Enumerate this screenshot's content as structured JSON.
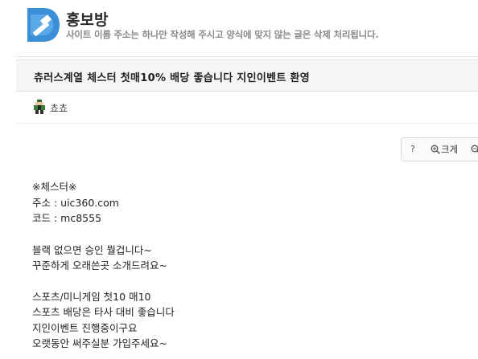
{
  "board": {
    "title": "홍보방",
    "description": "사이트 이름 주소는 하나만 작성해 주시고 양식에 맞지 않는 글은 삭제 처리됩니다."
  },
  "post": {
    "title": "츄러스계열 체스터 첫매10% 배당 좋습니다 지인이벤트 환영",
    "author": "쵸쵸"
  },
  "font_tools": {
    "help_label": "?",
    "enlarge_label": "크게"
  },
  "content": {
    "line1": "※체스터※",
    "line2": "주소 : uic360.com",
    "line3": "코드 : mc8555",
    "line4": "블랙 없으면 승인 뭘겁니다~",
    "line5": "꾸준하게 오래쓴곳 소개드려요~",
    "line6": "스포츠/미니게임  첫10 매10",
    "line7": "스포츠 배당은 타사 대비 좋습니다",
    "line8": "지인이벤트 진행중이구요",
    "line9": "오랫동안 써주실분 가입주세요~"
  },
  "colors": {
    "logo_blue": "#3b8fd6",
    "title_bar_bg": "#f5f5f5"
  }
}
